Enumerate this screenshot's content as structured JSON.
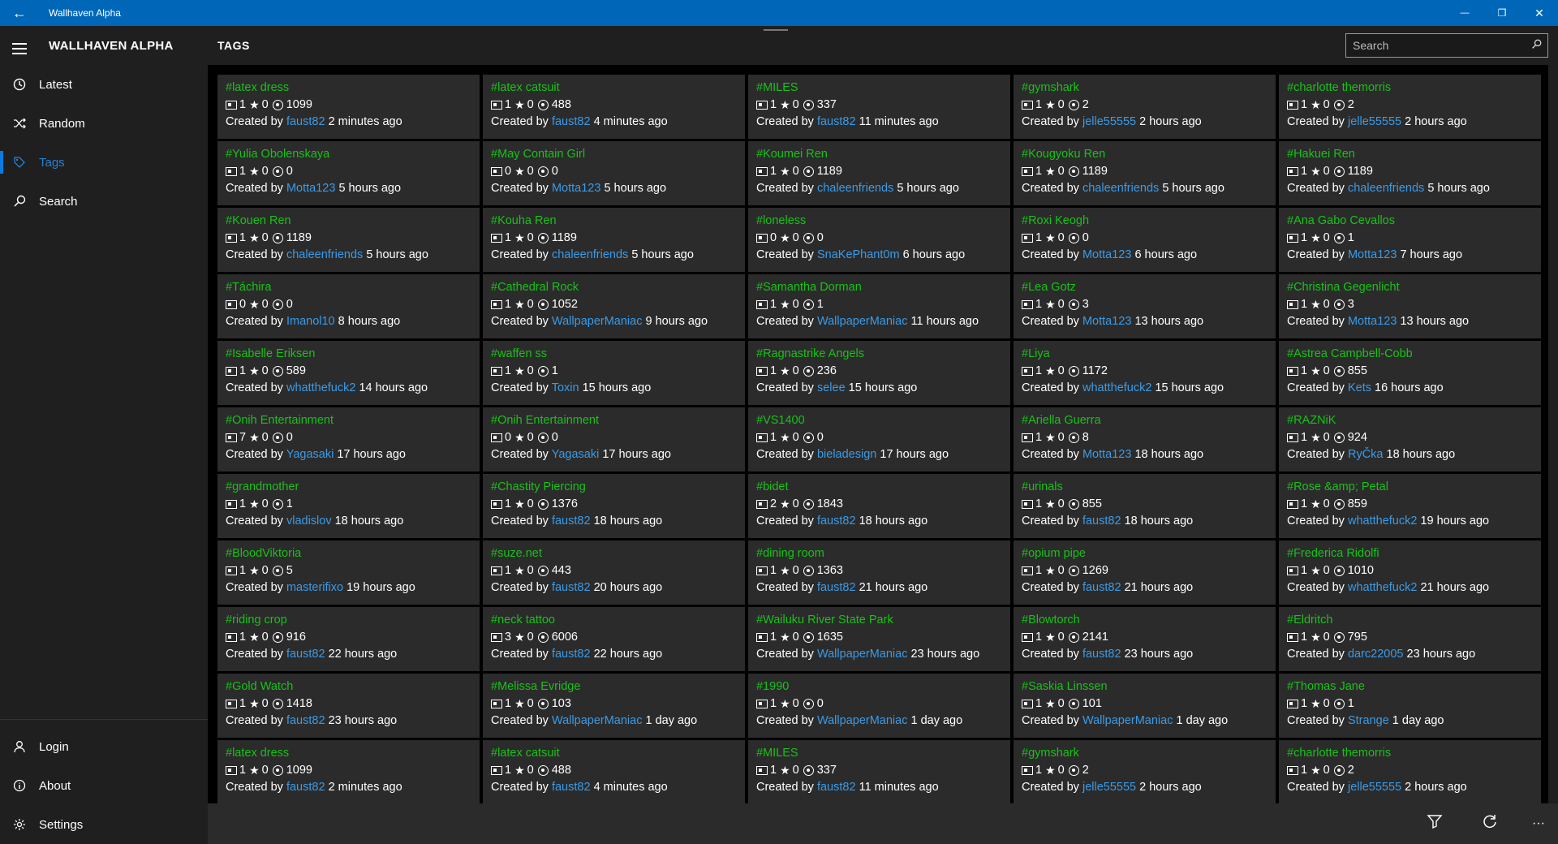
{
  "window": {
    "title": "Wallhaven Alpha",
    "back_glyph": "←",
    "minimize_glyph": "—",
    "maximize_glyph": "❐",
    "close_glyph": "✕"
  },
  "app": {
    "name": "WALLHAVEN ALPHA"
  },
  "nav": {
    "items": [
      {
        "label": "Latest",
        "icon": "clock-icon"
      },
      {
        "label": "Random",
        "icon": "shuffle-icon"
      },
      {
        "label": "Tags",
        "icon": "tag-icon",
        "active": true
      },
      {
        "label": "Search",
        "icon": "search-icon"
      }
    ],
    "bottom": [
      {
        "label": "Login",
        "icon": "person-icon"
      },
      {
        "label": "About",
        "icon": "info-icon"
      },
      {
        "label": "Settings",
        "icon": "gear-icon"
      }
    ]
  },
  "page": {
    "title": "TAGS"
  },
  "search": {
    "placeholder": "Search",
    "value": ""
  },
  "labels": {
    "created_by": "Created by"
  },
  "colors": {
    "accent": "#0067b8",
    "tag_green": "#18c218",
    "author_blue": "#3a9be8"
  },
  "tags": [
    {
      "name": "#latex dress",
      "wallpapers": "1",
      "favorites": "0",
      "views": "1099",
      "author": "faust82",
      "time": "2 minutes ago"
    },
    {
      "name": "#latex catsuit",
      "wallpapers": "1",
      "favorites": "0",
      "views": "488",
      "author": "faust82",
      "time": "4 minutes ago"
    },
    {
      "name": "#MILES",
      "wallpapers": "1",
      "favorites": "0",
      "views": "337",
      "author": "faust82",
      "time": "11 minutes ago"
    },
    {
      "name": "#gymshark",
      "wallpapers": "1",
      "favorites": "0",
      "views": "2",
      "author": "jelle55555",
      "time": "2 hours ago"
    },
    {
      "name": "#charlotte themorris",
      "wallpapers": "1",
      "favorites": "0",
      "views": "2",
      "author": "jelle55555",
      "time": "2 hours ago"
    },
    {
      "name": "#Yulia Obolenskaya",
      "wallpapers": "1",
      "favorites": "0",
      "views": "0",
      "author": "Motta123",
      "time": "5 hours ago"
    },
    {
      "name": "#May Contain Girl",
      "wallpapers": "0",
      "favorites": "0",
      "views": "0",
      "author": "Motta123",
      "time": "5 hours ago"
    },
    {
      "name": "#Koumei Ren",
      "wallpapers": "1",
      "favorites": "0",
      "views": "1189",
      "author": "chaleenfriends",
      "time": "5 hours ago"
    },
    {
      "name": "#Kougyoku Ren",
      "wallpapers": "1",
      "favorites": "0",
      "views": "1189",
      "author": "chaleenfriends",
      "time": "5 hours ago"
    },
    {
      "name": "#Hakuei Ren",
      "wallpapers": "1",
      "favorites": "0",
      "views": "1189",
      "author": "chaleenfriends",
      "time": "5 hours ago"
    },
    {
      "name": "#Kouen Ren",
      "wallpapers": "1",
      "favorites": "0",
      "views": "1189",
      "author": "chaleenfriends",
      "time": "5 hours ago"
    },
    {
      "name": "#Kouha Ren",
      "wallpapers": "1",
      "favorites": "0",
      "views": "1189",
      "author": "chaleenfriends",
      "time": "5 hours ago"
    },
    {
      "name": "#loneless",
      "wallpapers": "0",
      "favorites": "0",
      "views": "0",
      "author": "SnaKePhant0m",
      "time": "6 hours ago"
    },
    {
      "name": "#Roxi Keogh",
      "wallpapers": "1",
      "favorites": "0",
      "views": "0",
      "author": "Motta123",
      "time": "6 hours ago"
    },
    {
      "name": "#Ana Gabo Cevallos",
      "wallpapers": "1",
      "favorites": "0",
      "views": "1",
      "author": "Motta123",
      "time": "7 hours ago"
    },
    {
      "name": "#Táchira",
      "wallpapers": "0",
      "favorites": "0",
      "views": "0",
      "author": "Imanol10",
      "time": "8 hours ago"
    },
    {
      "name": "#Cathedral Rock",
      "wallpapers": "1",
      "favorites": "0",
      "views": "1052",
      "author": "WallpaperManiac",
      "time": "9 hours ago"
    },
    {
      "name": "#Samantha Dorman",
      "wallpapers": "1",
      "favorites": "0",
      "views": "1",
      "author": "WallpaperManiac",
      "time": "11 hours ago"
    },
    {
      "name": "#Lea Gotz",
      "wallpapers": "1",
      "favorites": "0",
      "views": "3",
      "author": "Motta123",
      "time": "13 hours ago"
    },
    {
      "name": "#Christina Gegenlicht",
      "wallpapers": "1",
      "favorites": "0",
      "views": "3",
      "author": "Motta123",
      "time": "13 hours ago"
    },
    {
      "name": "#Isabelle Eriksen",
      "wallpapers": "1",
      "favorites": "0",
      "views": "589",
      "author": "whatthefuck2",
      "time": "14 hours ago"
    },
    {
      "name": "#waffen ss",
      "wallpapers": "1",
      "favorites": "0",
      "views": "1",
      "author": "Toxin",
      "time": "15 hours ago"
    },
    {
      "name": "#Ragnastrike Angels",
      "wallpapers": "1",
      "favorites": "0",
      "views": "236",
      "author": "selee",
      "time": "15 hours ago"
    },
    {
      "name": "#Liya",
      "wallpapers": "1",
      "favorites": "0",
      "views": "1172",
      "author": "whatthefuck2",
      "time": "15 hours ago"
    },
    {
      "name": "#Astrea Campbell-Cobb",
      "wallpapers": "1",
      "favorites": "0",
      "views": "855",
      "author": "Kets",
      "time": "16 hours ago"
    },
    {
      "name": "#Onih Entertainment",
      "wallpapers": "7",
      "favorites": "0",
      "views": "0",
      "author": "Yagasaki",
      "time": "17 hours ago"
    },
    {
      "name": "#Onih Entertainment",
      "wallpapers": "0",
      "favorites": "0",
      "views": "0",
      "author": "Yagasaki",
      "time": "17 hours ago"
    },
    {
      "name": "#VS1400",
      "wallpapers": "1",
      "favorites": "0",
      "views": "0",
      "author": "bieladesign",
      "time": "17 hours ago"
    },
    {
      "name": "#Ariella Guerra",
      "wallpapers": "1",
      "favorites": "0",
      "views": "8",
      "author": "Motta123",
      "time": "18 hours ago"
    },
    {
      "name": "#RAZNiK",
      "wallpapers": "1",
      "favorites": "0",
      "views": "924",
      "author": "RyČka",
      "time": "18 hours ago"
    },
    {
      "name": "#grandmother",
      "wallpapers": "1",
      "favorites": "0",
      "views": "1",
      "author": "vladislov",
      "time": "18 hours ago"
    },
    {
      "name": "#Chastity Piercing",
      "wallpapers": "1",
      "favorites": "0",
      "views": "1376",
      "author": "faust82",
      "time": "18 hours ago"
    },
    {
      "name": "#bidet",
      "wallpapers": "2",
      "favorites": "0",
      "views": "1843",
      "author": "faust82",
      "time": "18 hours ago"
    },
    {
      "name": "#urinals",
      "wallpapers": "1",
      "favorites": "0",
      "views": "855",
      "author": "faust82",
      "time": "18 hours ago"
    },
    {
      "name": "#Rose &amp; Petal",
      "wallpapers": "1",
      "favorites": "0",
      "views": "859",
      "author": "whatthefuck2",
      "time": "19 hours ago"
    },
    {
      "name": "#BloodViktoria",
      "wallpapers": "1",
      "favorites": "0",
      "views": "5",
      "author": "masterifixo",
      "time": "19 hours ago"
    },
    {
      "name": "#suze.net",
      "wallpapers": "1",
      "favorites": "0",
      "views": "443",
      "author": "faust82",
      "time": "20 hours ago"
    },
    {
      "name": "#dining room",
      "wallpapers": "1",
      "favorites": "0",
      "views": "1363",
      "author": "faust82",
      "time": "21 hours ago"
    },
    {
      "name": "#opium pipe",
      "wallpapers": "1",
      "favorites": "0",
      "views": "1269",
      "author": "faust82",
      "time": "21 hours ago"
    },
    {
      "name": "#Frederica Ridolfi",
      "wallpapers": "1",
      "favorites": "0",
      "views": "1010",
      "author": "whatthefuck2",
      "time": "21 hours ago"
    },
    {
      "name": "#riding crop",
      "wallpapers": "1",
      "favorites": "0",
      "views": "916",
      "author": "faust82",
      "time": "22 hours ago"
    },
    {
      "name": "#neck tattoo",
      "wallpapers": "3",
      "favorites": "0",
      "views": "6006",
      "author": "faust82",
      "time": "22 hours ago"
    },
    {
      "name": "#Wailuku River State Park",
      "wallpapers": "1",
      "favorites": "0",
      "views": "1635",
      "author": "WallpaperManiac",
      "time": "23 hours ago"
    },
    {
      "name": "#Blowtorch",
      "wallpapers": "1",
      "favorites": "0",
      "views": "2141",
      "author": "faust82",
      "time": "23 hours ago"
    },
    {
      "name": "#Eldritch",
      "wallpapers": "1",
      "favorites": "0",
      "views": "795",
      "author": "darc22005",
      "time": "23 hours ago"
    },
    {
      "name": "#Gold Watch",
      "wallpapers": "1",
      "favorites": "0",
      "views": "1418",
      "author": "faust82",
      "time": "23 hours ago"
    },
    {
      "name": "#Melissa Evridge",
      "wallpapers": "1",
      "favorites": "0",
      "views": "103",
      "author": "WallpaperManiac",
      "time": "1 day ago"
    },
    {
      "name": "#1990",
      "wallpapers": "1",
      "favorites": "0",
      "views": "0",
      "author": "WallpaperManiac",
      "time": "1 day ago"
    },
    {
      "name": "#Saskia Linssen",
      "wallpapers": "1",
      "favorites": "0",
      "views": "101",
      "author": "WallpaperManiac",
      "time": "1 day ago"
    },
    {
      "name": "#Thomas Jane",
      "wallpapers": "1",
      "favorites": "0",
      "views": "1",
      "author": "Strange",
      "time": "1 day ago"
    },
    {
      "name": "#latex dress",
      "wallpapers": "1",
      "favorites": "0",
      "views": "1099",
      "author": "faust82",
      "time": "2 minutes ago"
    },
    {
      "name": "#latex catsuit",
      "wallpapers": "1",
      "favorites": "0",
      "views": "488",
      "author": "faust82",
      "time": "4 minutes ago"
    },
    {
      "name": "#MILES",
      "wallpapers": "1",
      "favorites": "0",
      "views": "337",
      "author": "faust82",
      "time": "11 minutes ago"
    },
    {
      "name": "#gymshark",
      "wallpapers": "1",
      "favorites": "0",
      "views": "2",
      "author": "jelle55555",
      "time": "2 hours ago"
    },
    {
      "name": "#charlotte themorris",
      "wallpapers": "1",
      "favorites": "0",
      "views": "2",
      "author": "jelle55555",
      "time": "2 hours ago"
    }
  ],
  "commandbar": {
    "filter_icon": "filter-icon",
    "refresh_icon": "refresh-icon",
    "more_glyph": "···"
  }
}
